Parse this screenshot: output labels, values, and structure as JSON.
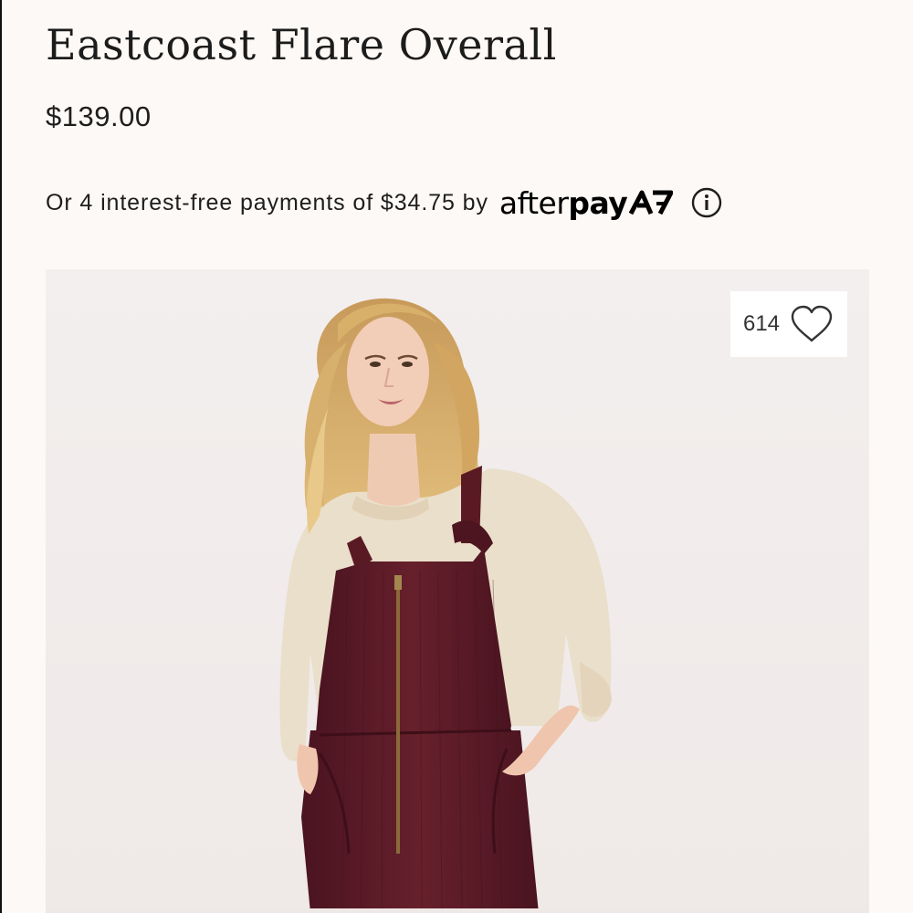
{
  "product": {
    "title": "Eastcoast Flare Overall",
    "price": "$139.00"
  },
  "afterpay": {
    "text": "Or 4 interest-free payments of $34.75 by",
    "logo_part1": "after",
    "logo_part2": "pay",
    "logo_icon": "afterpay-arrows-icon",
    "info_icon": "info-icon"
  },
  "image": {
    "alt": "Eastcoast Flare Overall"
  },
  "favorite": {
    "count": "614",
    "icon": "heart-icon"
  },
  "colors": {
    "background": "#fdf9f6",
    "text": "#1e1e1e",
    "overall": "#5a1a24",
    "sweater": "#ecdfca"
  }
}
